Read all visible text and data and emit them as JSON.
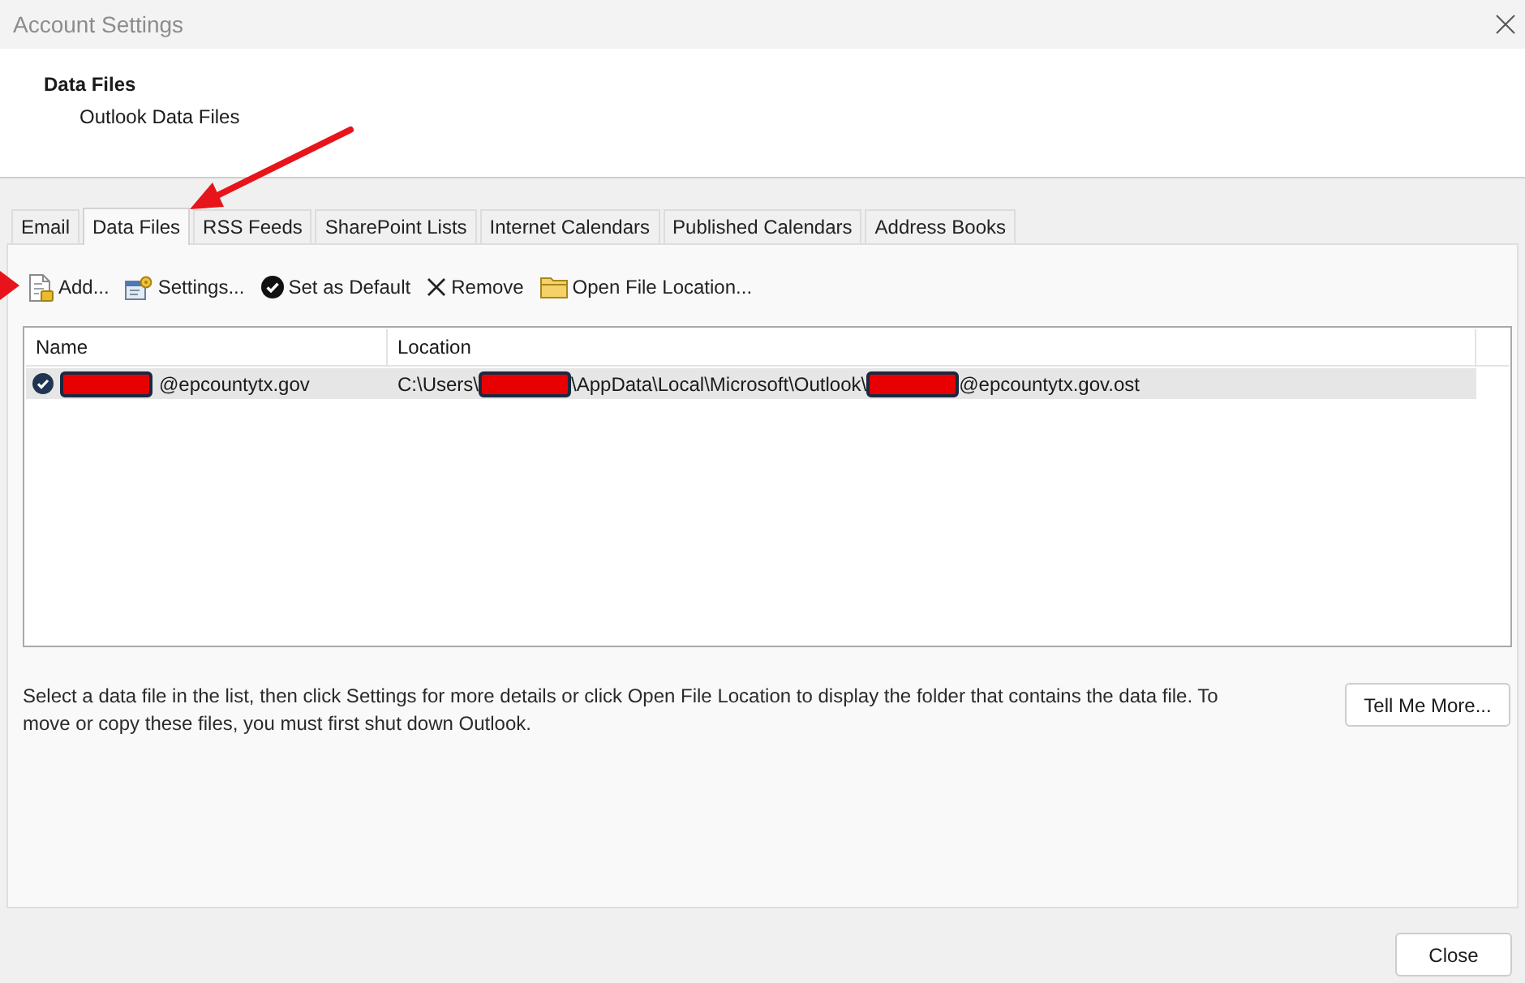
{
  "window": {
    "title": "Account Settings"
  },
  "header": {
    "title": "Data Files",
    "subtitle": "Outlook Data Files"
  },
  "tabs": [
    {
      "label": "Email",
      "selected": false
    },
    {
      "label": "Data Files",
      "selected": true
    },
    {
      "label": "RSS Feeds",
      "selected": false
    },
    {
      "label": "SharePoint Lists",
      "selected": false
    },
    {
      "label": "Internet Calendars",
      "selected": false
    },
    {
      "label": "Published Calendars",
      "selected": false
    },
    {
      "label": "Address Books",
      "selected": false
    }
  ],
  "toolbar": [
    {
      "kind": "add",
      "label": "Add..."
    },
    {
      "kind": "settings",
      "label": "Settings..."
    },
    {
      "kind": "default",
      "label": "Set as Default"
    },
    {
      "kind": "remove",
      "label": "Remove"
    },
    {
      "kind": "open",
      "label": "Open File Location..."
    }
  ],
  "table": {
    "columns": [
      "Name",
      "Location"
    ],
    "rows": [
      {
        "selected": true,
        "is_default": true,
        "name": [
          {
            "kind": "redacted"
          },
          {
            "kind": "text",
            "text": "@epcountytx.gov"
          }
        ],
        "location": [
          {
            "kind": "text",
            "text": "C:\\Users\\"
          },
          {
            "kind": "redacted"
          },
          {
            "kind": "text",
            "text": "\\AppData\\Local\\Microsoft\\Outlook\\"
          },
          {
            "kind": "redacted"
          },
          {
            "kind": "text",
            "text": "@epcountytx.gov.ost"
          }
        ]
      }
    ]
  },
  "hint": "Select a data file in the list, then click Settings for more details or click Open File Location to display the folder that contains the data file. To move or copy these files, you must first shut down Outlook.",
  "buttons": {
    "more": "Tell Me More...",
    "close": "Close"
  },
  "annotations": [
    {
      "kind": "arrow"
    },
    {
      "kind": "arrow"
    }
  ]
}
